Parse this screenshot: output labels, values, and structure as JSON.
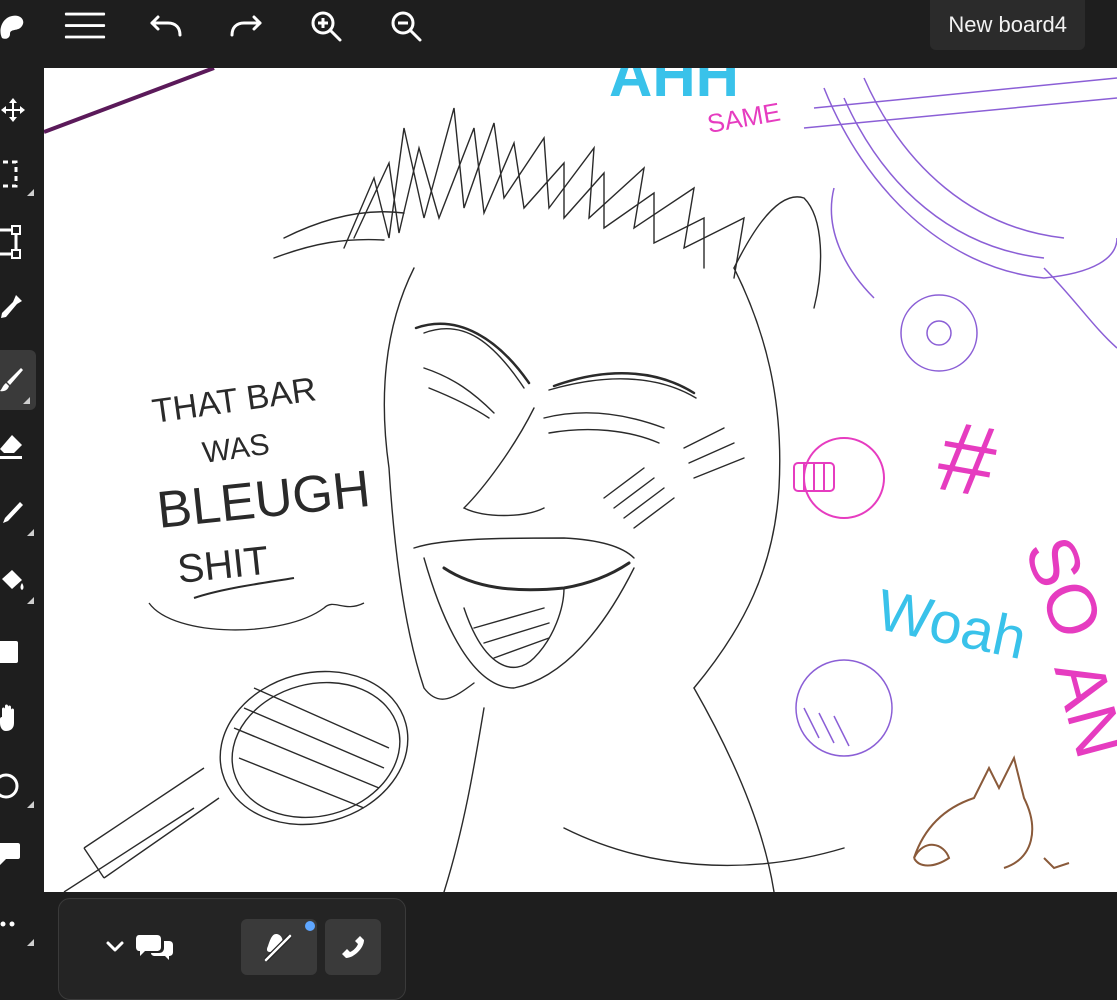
{
  "app": {
    "board_title": "New board4"
  },
  "topbar": {
    "icons": [
      "logo-icon",
      "menu-icon",
      "undo-icon",
      "redo-icon",
      "zoom-in-icon",
      "zoom-out-icon"
    ]
  },
  "tools": [
    {
      "name": "move-tool",
      "has_submenu": false
    },
    {
      "name": "select-tool",
      "has_submenu": true
    },
    {
      "name": "transform-tool",
      "has_submenu": false
    },
    {
      "name": "eyedropper-tool",
      "has_submenu": false
    },
    {
      "name": "brush-tool",
      "has_submenu": true,
      "active": true
    },
    {
      "name": "eraser-tool",
      "has_submenu": false
    },
    {
      "name": "pen-tool",
      "has_submenu": true
    },
    {
      "name": "fill-tool",
      "has_submenu": true
    },
    {
      "name": "rectangle-tool",
      "has_submenu": false
    },
    {
      "name": "hand-tool",
      "has_submenu": false
    },
    {
      "name": "ellipse-tool",
      "has_submenu": true
    },
    {
      "name": "comment-tool",
      "has_submenu": false
    },
    {
      "name": "more-tool",
      "has_submenu": true
    }
  ],
  "canvas": {
    "texts": {
      "speech_line1": "THAT BAR",
      "speech_line2": "WAS",
      "speech_line3": "BLEUGH",
      "speech_line4": "SHIT",
      "top_text": "AHH",
      "top_sub": "SAME",
      "woah": "Woah",
      "hash": "#",
      "so_text": "SO",
      "an_text": "AN"
    },
    "colors": {
      "pencil": "#2a2a2a",
      "purple": "#8b5fd6",
      "pink": "#e63cc0",
      "cyan": "#39c2ea",
      "brown": "#8a5a3a",
      "plum_line": "#5b1a5a"
    }
  },
  "bottom": {
    "icons": [
      "chevron-down-icon",
      "chat-icon",
      "voice-mute-icon",
      "phone-icon"
    ],
    "notification": true
  }
}
